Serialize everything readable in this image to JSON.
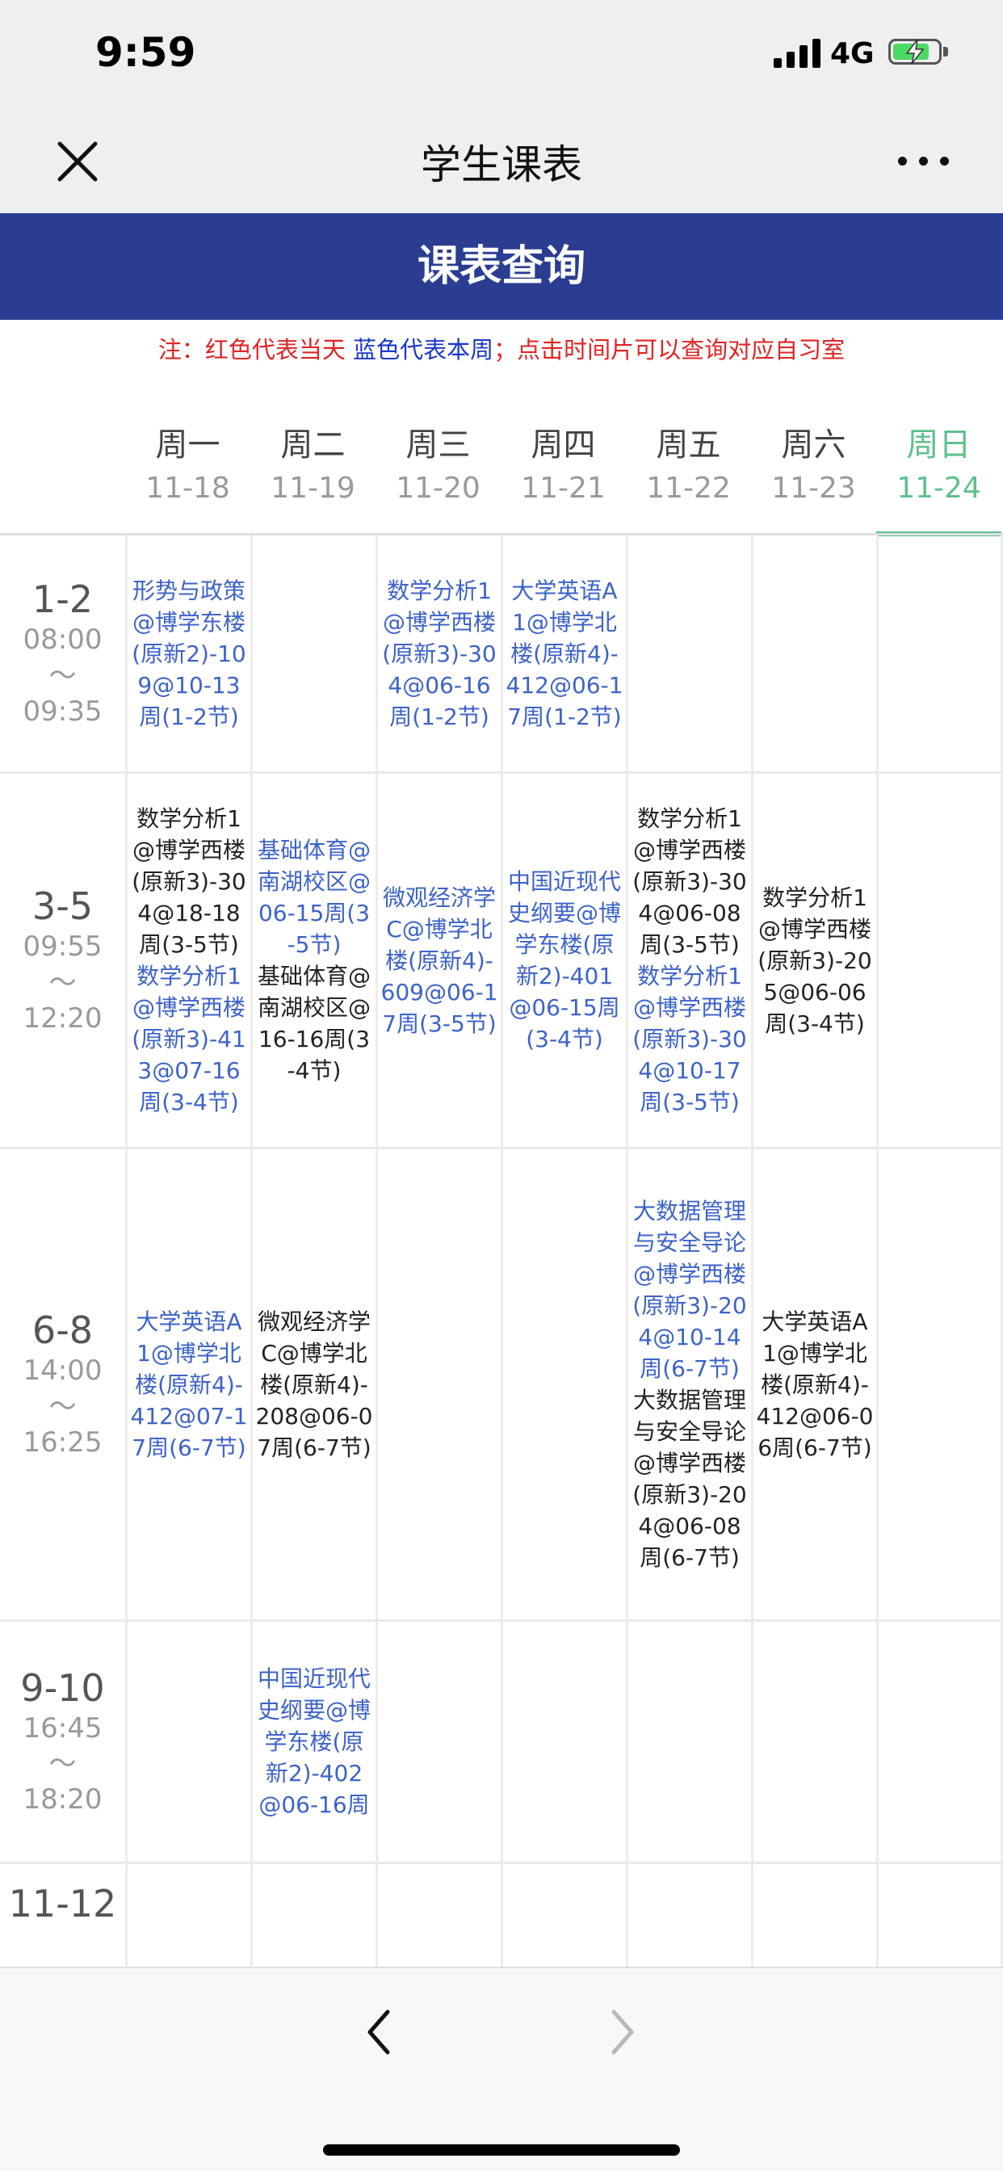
{
  "status_bar": {
    "time": "9:59",
    "network": "4G",
    "signal_icon": "signal-bars-icon",
    "battery_icon": "battery-charging-icon"
  },
  "nav_bar": {
    "title": "学生课表",
    "close_icon": "close-icon",
    "more_icon": "more-icon"
  },
  "header": {
    "title": "课表查询"
  },
  "note": {
    "part1": "注：红色代表当天 ",
    "part2": "蓝色代表本周",
    "part3": "；点击时间片可以查询对应自习室",
    "colors": {
      "today": "#e02424",
      "this_week": "#1a37c8"
    }
  },
  "days": [
    {
      "name": "周一",
      "date": "11-18",
      "active": false
    },
    {
      "name": "周二",
      "date": "11-19",
      "active": false
    },
    {
      "name": "周三",
      "date": "11-20",
      "active": false
    },
    {
      "name": "周四",
      "date": "11-21",
      "active": false
    },
    {
      "name": "周五",
      "date": "11-22",
      "active": false
    },
    {
      "name": "周六",
      "date": "11-23",
      "active": false
    },
    {
      "name": "周日",
      "date": "11-24",
      "active": true
    }
  ],
  "periods": [
    {
      "label": "1-2",
      "start": "08:00",
      "sep": "～",
      "end": "09:35",
      "cells": [
        [
          {
            "text": "形势与政策@博学东楼(原新2)-109@10-13周(1-2节)",
            "current": true
          }
        ],
        [],
        [
          {
            "text": "数学分析1@博学西楼(原新3)-304@06-16周(1-2节)",
            "current": true
          }
        ],
        [
          {
            "text": "大学英语A1@博学北楼(原新4)-412@06-17周(1-2节)",
            "current": true
          }
        ],
        [],
        [],
        []
      ]
    },
    {
      "label": "3-5",
      "start": "09:55",
      "sep": "～",
      "end": "12:20",
      "cells": [
        [
          {
            "text": "数学分析1@博学西楼(原新3)-304@18-18周(3-5节)",
            "current": false
          },
          {
            "text": "数学分析1@博学西楼(原新3)-413@07-16周(3-4节)",
            "current": true
          }
        ],
        [
          {
            "text": "基础体育@南湖校区@06-15周(3-5节)",
            "current": true
          },
          {
            "text": "基础体育@南湖校区@16-16周(3-4节)",
            "current": false
          }
        ],
        [
          {
            "text": "微观经济学C@博学北楼(原新4)-609@06-17周(3-5节)",
            "current": true
          }
        ],
        [
          {
            "text": "中国近现代史纲要@博学东楼(原新2)-401@06-15周(3-4节)",
            "current": true
          }
        ],
        [
          {
            "text": "数学分析1@博学西楼(原新3)-304@06-08周(3-5节)",
            "current": false
          },
          {
            "text": "数学分析1@博学西楼(原新3)-304@10-17周(3-5节)",
            "current": true
          }
        ],
        [
          {
            "text": "数学分析1@博学西楼(原新3)-205@06-06周(3-4节)",
            "current": false
          }
        ],
        []
      ]
    },
    {
      "label": "6-8",
      "start": "14:00",
      "sep": "～",
      "end": "16:25",
      "cells": [
        [
          {
            "text": "大学英语A1@博学北楼(原新4)-412@07-17周(6-7节)",
            "current": true
          }
        ],
        [
          {
            "text": "微观经济学C@博学北楼(原新4)-208@06-07周(6-7节)",
            "current": false
          }
        ],
        [],
        [],
        [
          {
            "text": "大数据管理与安全导论@博学西楼(原新3)-204@10-14周(6-7节)",
            "current": true
          },
          {
            "text": "大数据管理与安全导论@博学西楼(原新3)-204@06-08周(6-7节)",
            "current": false
          }
        ],
        [
          {
            "text": "大学英语A1@博学北楼(原新4)-412@06-06周(6-7节)",
            "current": false
          }
        ],
        []
      ]
    },
    {
      "label": "9-10",
      "start": "16:45",
      "sep": "～",
      "end": "18:20",
      "cells": [
        [],
        [
          {
            "text": "中国近现代史纲要@博学东楼(原新2)-402@06-16周",
            "current": true
          }
        ],
        [],
        [],
        [],
        [],
        []
      ]
    },
    {
      "label": "11-12",
      "start": "",
      "sep": "",
      "end": "",
      "cells": [
        [],
        [],
        [],
        [],
        [],
        [],
        []
      ]
    }
  ],
  "toolbar": {
    "back_icon": "chevron-left-icon",
    "forward_icon": "chevron-right-icon"
  },
  "colors": {
    "header_bg": "#2a3d91",
    "current_week_text": "#3d63c9",
    "active_day": "#5ec08c"
  }
}
